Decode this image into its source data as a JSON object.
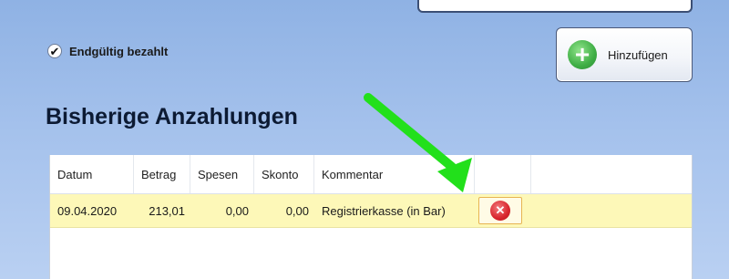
{
  "form": {
    "final_paid_label": "Endgültig bezahlt",
    "final_paid_checked": true,
    "add_button_label": "Hinzufügen"
  },
  "section": {
    "title": "Bisherige Anzahlungen"
  },
  "table": {
    "columns": [
      "Datum",
      "Betrag",
      "Spesen",
      "Skonto",
      "Kommentar"
    ],
    "rows": [
      {
        "datum": "09.04.2020",
        "betrag": "213,01",
        "spesen": "0,00",
        "skonto": "0,00",
        "kommentar": "Registrierkasse (in Bar)"
      }
    ]
  },
  "icons": {
    "add": "plus-circle-icon",
    "delete": "delete-x-icon",
    "check": "checkmark-icon",
    "arrow": "green-arrow-icon"
  },
  "colors": {
    "arrow": "#22e01b",
    "selected_row": "#fdf8b8",
    "plus": "#3fae45",
    "delete": "#d8262d"
  }
}
